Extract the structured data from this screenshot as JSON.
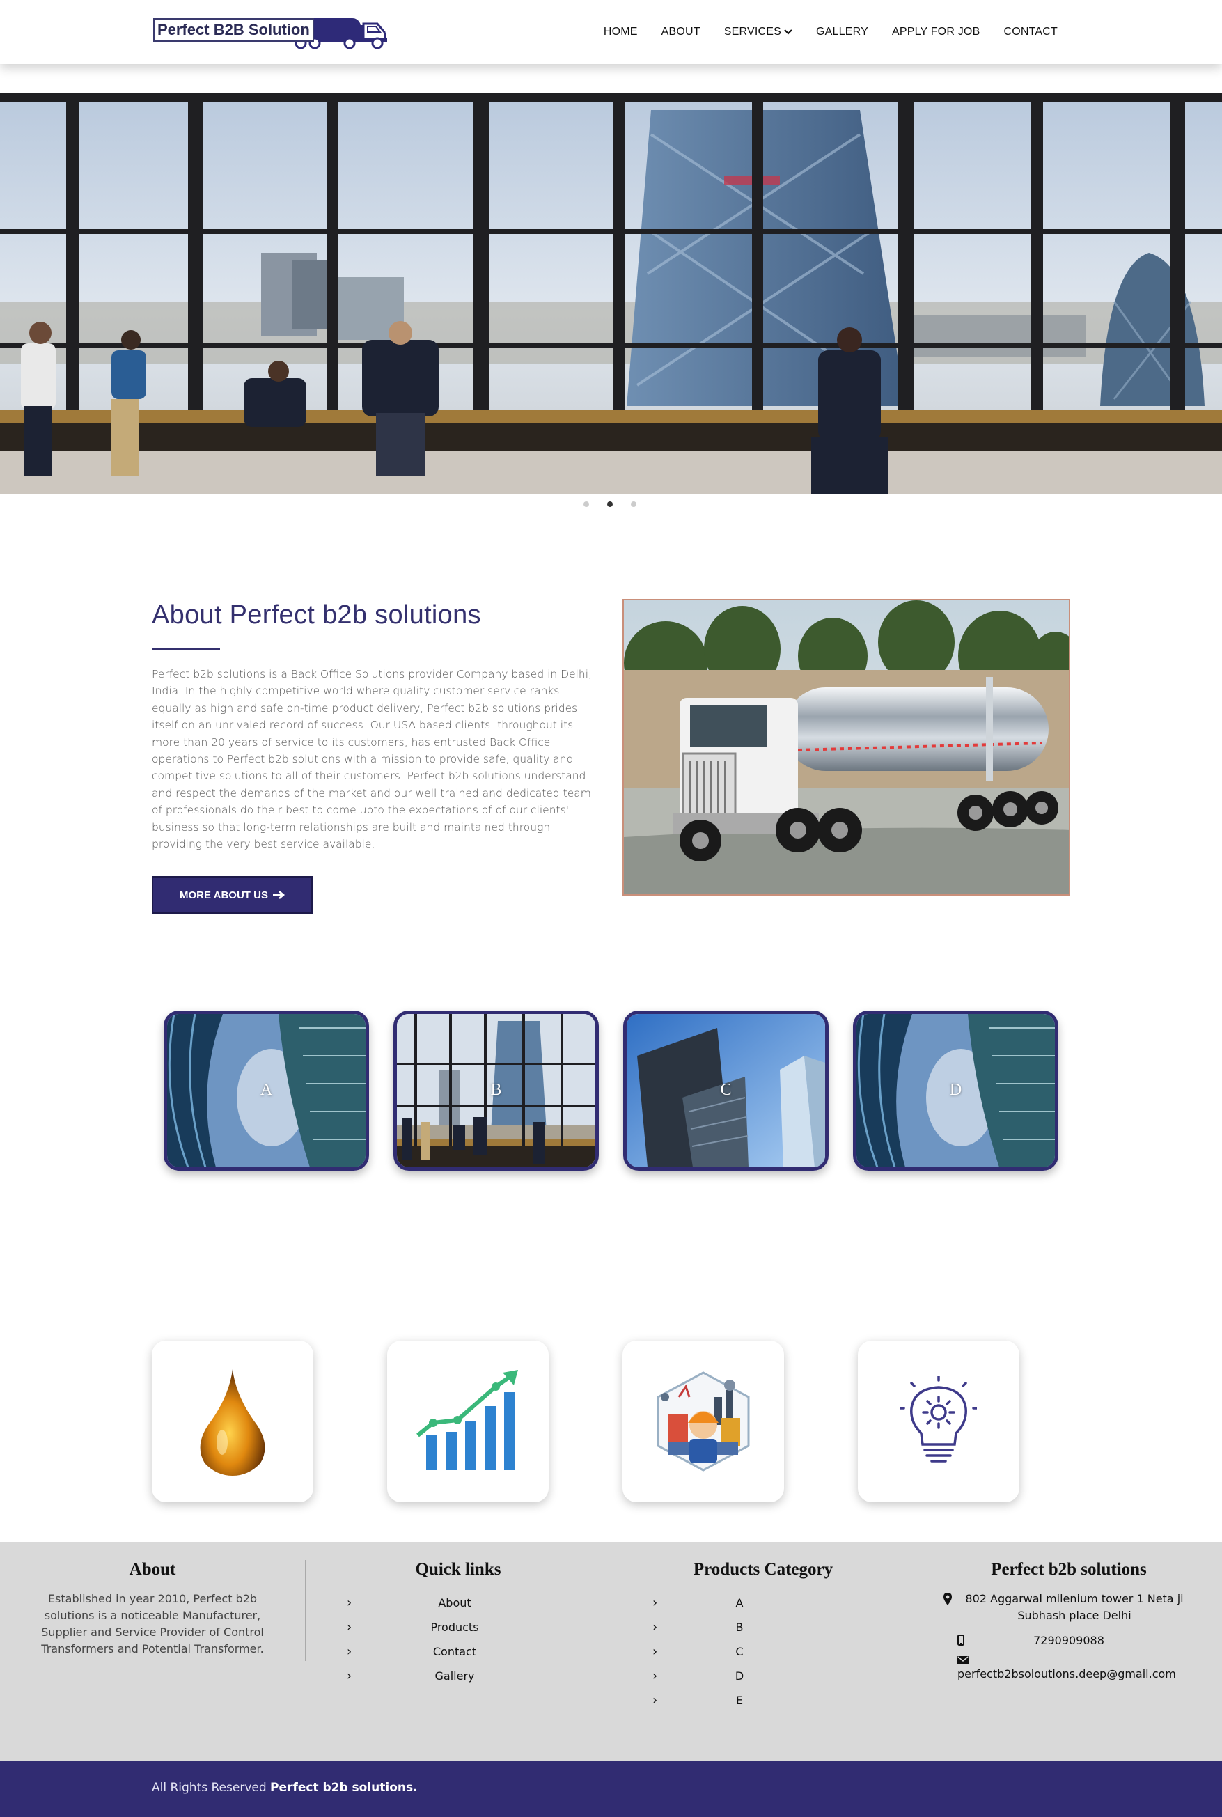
{
  "header": {
    "logo_text": "Perfect B2B Solution",
    "nav": [
      {
        "label": "HOME"
      },
      {
        "label": "ABOUT"
      },
      {
        "label": "SERVICES"
      },
      {
        "label": "GALLERY"
      },
      {
        "label": "APPLY FOR JOB"
      },
      {
        "label": "CONTACT"
      }
    ]
  },
  "hero": {
    "slides": 3,
    "active_slide": 2
  },
  "about": {
    "title": "About Perfect b2b solutions",
    "text": "Perfect b2b solutions is a Back Office Solutions provider Company based in Delhi, India. In the highly competitive world where quality customer service ranks equally as high and safe on-time product delivery, Perfect b2b solutions prides itself on an unrivaled record of success. Our USA based clients, throughout its more than 20 years of service to its customers, has entrusted Back Office operations to Perfect b2b solutions with a mission to provide safe, quality and competitive solutions to all of their customers. Perfect b2b solutions understand and respect the demands of the market and our well trained and dedicated team of professionals do their best to come upto the expectations of of our clients' business so that long-term relationships are built and maintained through providing the very best service available.",
    "button_label": "MORE ABOUT US",
    "button_icon": "arrow-right-icon"
  },
  "categories": [
    {
      "label": "A"
    },
    {
      "label": "B"
    },
    {
      "label": "C"
    },
    {
      "label": "D"
    }
  ],
  "features": [
    {
      "icon": "oil-drop-icon"
    },
    {
      "icon": "growth-chart-icon"
    },
    {
      "icon": "industry-worker-icon"
    },
    {
      "icon": "idea-bulb-gear-icon"
    }
  ],
  "footer": {
    "about": {
      "title": "About",
      "text": "Established in year 2010, Perfect b2b solutions is a noticeable Manufacturer, Supplier and Service Provider of Control Transformers and Potential Transformer."
    },
    "quick_links": {
      "title": "Quick links",
      "items": [
        "About",
        "Products",
        "Contact",
        "Gallery"
      ]
    },
    "products": {
      "title": "Products Category",
      "items": [
        "A",
        "B",
        "C",
        "D",
        "E"
      ]
    },
    "company": {
      "title": "Perfect b2b solutions",
      "address": "802 Aggarwal milenium tower 1 Neta ji Subhash place Delhi",
      "phone": "7290909088",
      "email": "perfectb2bsoloutions.deep@gmail.com"
    },
    "copyright_prefix": "All Rights Reserved",
    "copyright_brand": "Perfect b2b solutions."
  },
  "colors": {
    "brand": "#312c72",
    "footer_bg": "#d9d9d9"
  }
}
